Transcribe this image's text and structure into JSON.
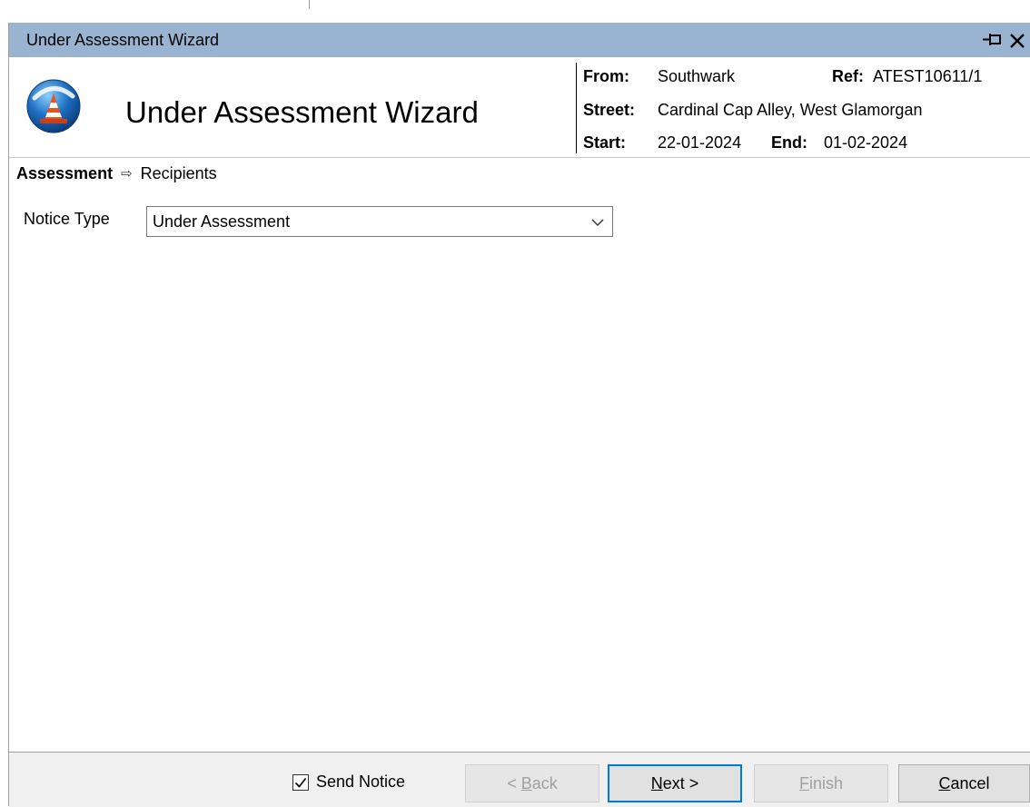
{
  "window": {
    "title": "Under Assessment Wizard"
  },
  "header": {
    "title": "Under Assessment Wizard",
    "from_label": "From:",
    "from_value": "Southwark",
    "ref_label": "Ref:",
    "ref_value": "ATEST10611/1",
    "street_label": "Street:",
    "street_value": "Cardinal Cap Alley, West Glamorgan",
    "start_label": "Start:",
    "start_value": "22-01-2024",
    "end_label": "End:",
    "end_value": "01-02-2024",
    "logo_icon": "traffic-cone-icon"
  },
  "breadcrumb": {
    "current": "Assessment",
    "arrow": "⇨",
    "next": "Recipients"
  },
  "form": {
    "notice_type_label": "Notice Type",
    "notice_type_value": "Under Assessment"
  },
  "footer": {
    "send_notice_label": "Send Notice",
    "send_notice_checked": true,
    "back_prefix": "< ",
    "back_mnemonic": "B",
    "back_rest": "ack",
    "next_mnemonic": "N",
    "next_rest": "ext >",
    "finish_mnemonic": "F",
    "finish_rest": "inish",
    "cancel_mnemonic": "C",
    "cancel_rest": "ancel"
  },
  "colors": {
    "titlebar": "#99b4d1",
    "default_button_border": "#0078d7",
    "logo_blue": "#1c6fc2",
    "cone_orange": "#e8531f"
  }
}
